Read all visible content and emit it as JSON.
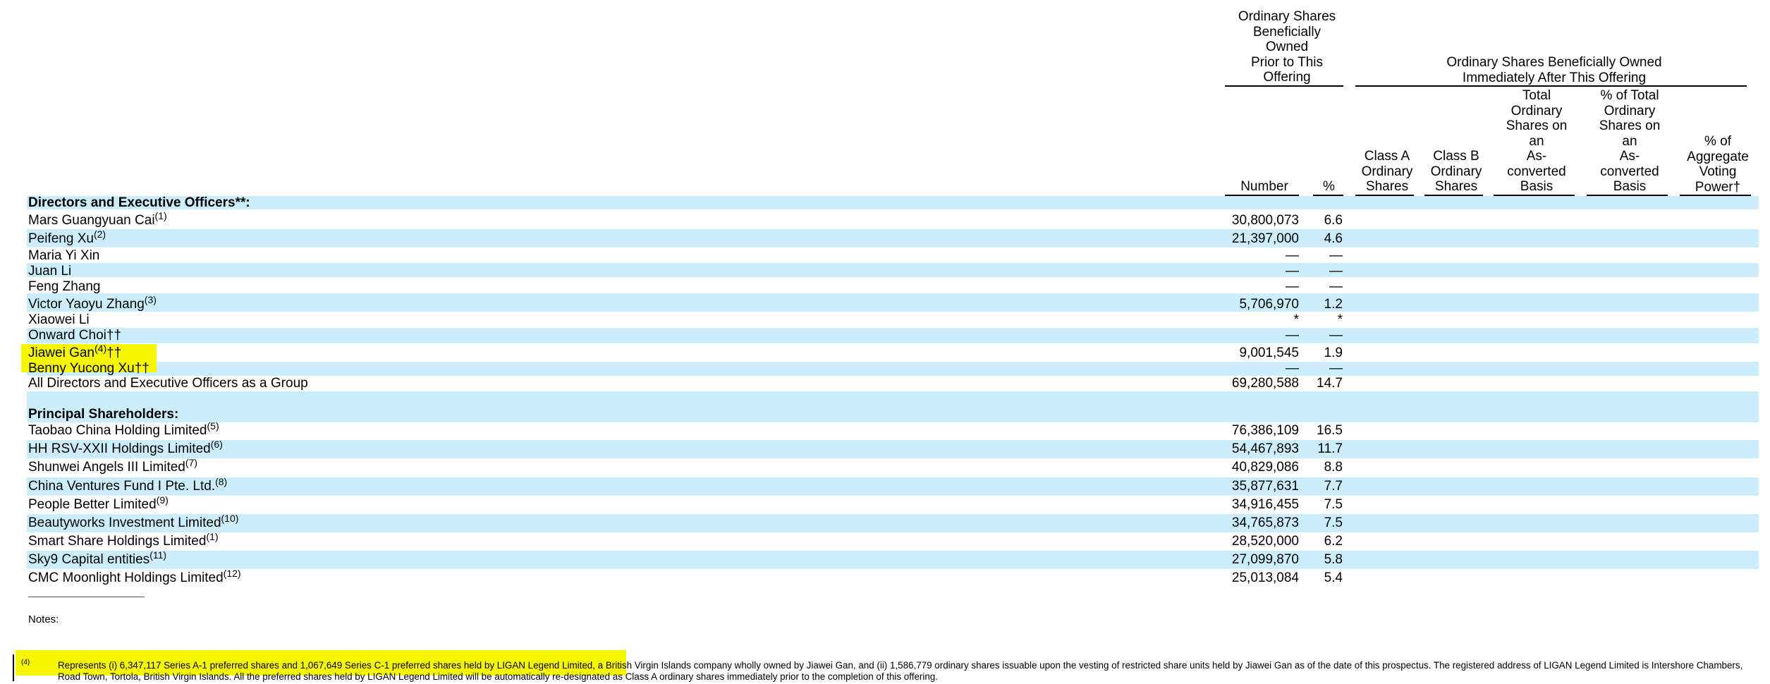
{
  "headers": {
    "prior_group": [
      "Ordinary Shares",
      "Beneficially",
      "Owned",
      "Prior to This",
      "Offering"
    ],
    "after_group": [
      "Ordinary Shares Beneficially Owned",
      "Immediately After This Offering"
    ],
    "number": "Number",
    "pct": "%",
    "class_a": [
      "Class A",
      "Ordinary",
      "Shares"
    ],
    "class_b": [
      "Class B",
      "Ordinary",
      "Shares"
    ],
    "total": [
      "Total",
      "Ordinary",
      "Shares on",
      "an",
      "As-",
      "converted",
      "Basis"
    ],
    "pct_total": [
      "% of Total",
      "Ordinary",
      "Shares on",
      "an",
      "As-",
      "converted",
      "Basis"
    ],
    "voting": [
      "% of",
      "Aggregate",
      "Voting",
      "Power†"
    ]
  },
  "rows": [
    {
      "label": "Directors and Executive Officers**:",
      "sup": "",
      "suffix": "",
      "number": "",
      "pct": "",
      "bold": true
    },
    {
      "label": "Mars Guangyuan Cai",
      "sup": "(1)",
      "suffix": "",
      "number": "30,800,073",
      "pct": "6.6"
    },
    {
      "label": "Peifeng Xu",
      "sup": "(2)",
      "suffix": "",
      "number": "21,397,000",
      "pct": "4.6"
    },
    {
      "label": "Maria Yi Xin",
      "sup": "",
      "suffix": "",
      "number": "—",
      "pct": "—"
    },
    {
      "label": "Juan Li",
      "sup": "",
      "suffix": "",
      "number": "—",
      "pct": "—"
    },
    {
      "label": "Feng Zhang",
      "sup": "",
      "suffix": "",
      "number": "—",
      "pct": "—"
    },
    {
      "label": "Victor Yaoyu Zhang",
      "sup": "(3)",
      "suffix": "",
      "number": "5,706,970",
      "pct": "1.2"
    },
    {
      "label": "Xiaowei Li",
      "sup": "",
      "suffix": "",
      "number": "*",
      "pct": "*"
    },
    {
      "label": "Onward Choi††",
      "sup": "",
      "suffix": "",
      "number": "—",
      "pct": "—"
    },
    {
      "label": "Jiawei Gan",
      "sup": "(4)",
      "suffix": "††",
      "number": "9,001,545",
      "pct": "1.9"
    },
    {
      "label": "Benny Yucong Xu††",
      "sup": "",
      "suffix": "",
      "number": "—",
      "pct": "—"
    },
    {
      "label": "All Directors and Executive Officers as a Group",
      "sup": "",
      "suffix": "",
      "number": "69,280,588",
      "pct": "14.7"
    },
    {
      "label": "Principal Shareholders:",
      "sup": "",
      "suffix": "",
      "number": "",
      "pct": "",
      "bold": true
    },
    {
      "label": "Taobao China Holding Limited",
      "sup": "(5)",
      "suffix": "",
      "number": "76,386,109",
      "pct": "16.5"
    },
    {
      "label": "HH RSV-XXII Holdings Limited",
      "sup": "(6)",
      "suffix": "",
      "number": "54,467,893",
      "pct": "11.7"
    },
    {
      "label": "Shunwei Angels III Limited",
      "sup": "(7)",
      "suffix": "",
      "number": "40,829,086",
      "pct": "8.8"
    },
    {
      "label": "China Ventures Fund I Pte. Ltd.",
      "sup": "(8)",
      "suffix": "",
      "number": "35,877,631",
      "pct": "7.7"
    },
    {
      "label": "People Better Limited",
      "sup": "(9)",
      "suffix": "",
      "number": "34,916,455",
      "pct": "7.5"
    },
    {
      "label": "Beautyworks Investment Limited",
      "sup": "(10)",
      "suffix": "",
      "number": "34,765,873",
      "pct": "7.5"
    },
    {
      "label": "Smart Share Holdings Limited",
      "sup": "(1)",
      "suffix": "",
      "number": "28,520,000",
      "pct": "6.2"
    },
    {
      "label": "Sky9 Capital entities",
      "sup": "(11)",
      "suffix": "",
      "number": "27,099,870",
      "pct": "5.8"
    },
    {
      "label": "CMC Moonlight Holdings Limited",
      "sup": "(12)",
      "suffix": "",
      "number": "25,013,084",
      "pct": "5.4"
    }
  ],
  "notes_label": "Notes:",
  "footnote": {
    "mark": "(4)",
    "text": "Represents (i) 6,347,117 Series A-1 preferred shares and 1,067,649 Series C-1 preferred shares held by LIGAN Legend Limited, a British Virgin Islands company wholly owned by Jiawei Gan, and (ii) 1,586,779 ordinary shares issuable upon the vesting of restricted share units held by Jiawei Gan as of the date of this prospectus. The registered address of LIGAN Legend Limited is Intershore Chambers, Road Town, Tortola, British Virgin Islands. All the preferred shares held by LIGAN Legend Limited will be automatically re-designated as Class A ordinary shares immediately prior to the completion of this offering."
  },
  "colors": {
    "band": "#cceefc",
    "highlight": "#f7f700"
  }
}
